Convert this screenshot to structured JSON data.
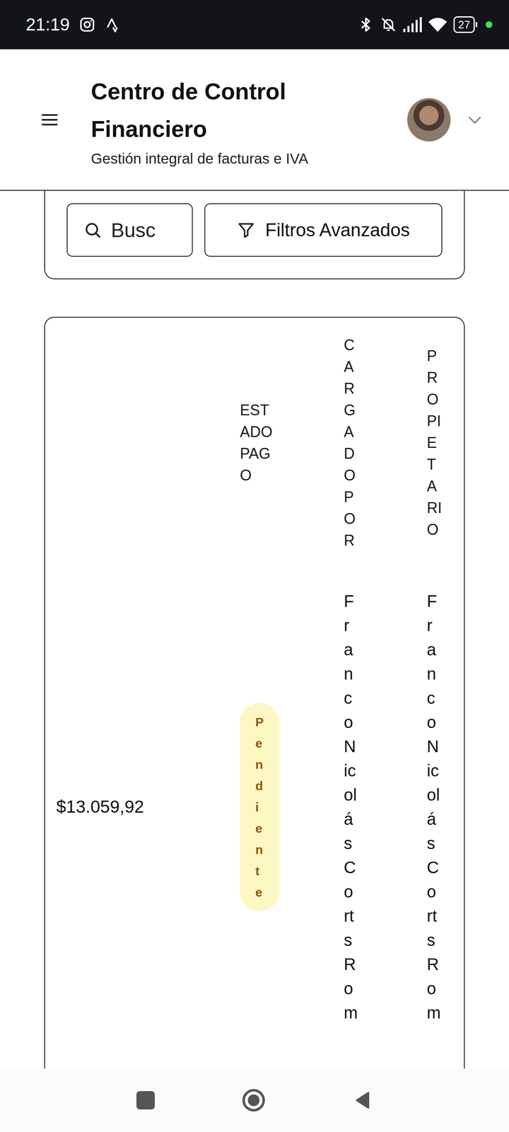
{
  "status_bar": {
    "time": "21:19",
    "battery": "27"
  },
  "header": {
    "title": "Centro de Control Financiero",
    "subtitle": "Gestión integral de facturas e IVA"
  },
  "search": {
    "placeholder": "Busc"
  },
  "filter_button": {
    "label": "Filtros Avanzados"
  },
  "table": {
    "columns": [
      "ESTADO PAGO",
      "CARGADO POR",
      "PROPIETARIO"
    ],
    "rows": [
      {
        "amount": "$13.059,92",
        "status": "Pendiente",
        "uploaded_by": "Franco Nicolás Corts Rom",
        "owner": "Franco Nicolás Corts Rom"
      }
    ]
  }
}
